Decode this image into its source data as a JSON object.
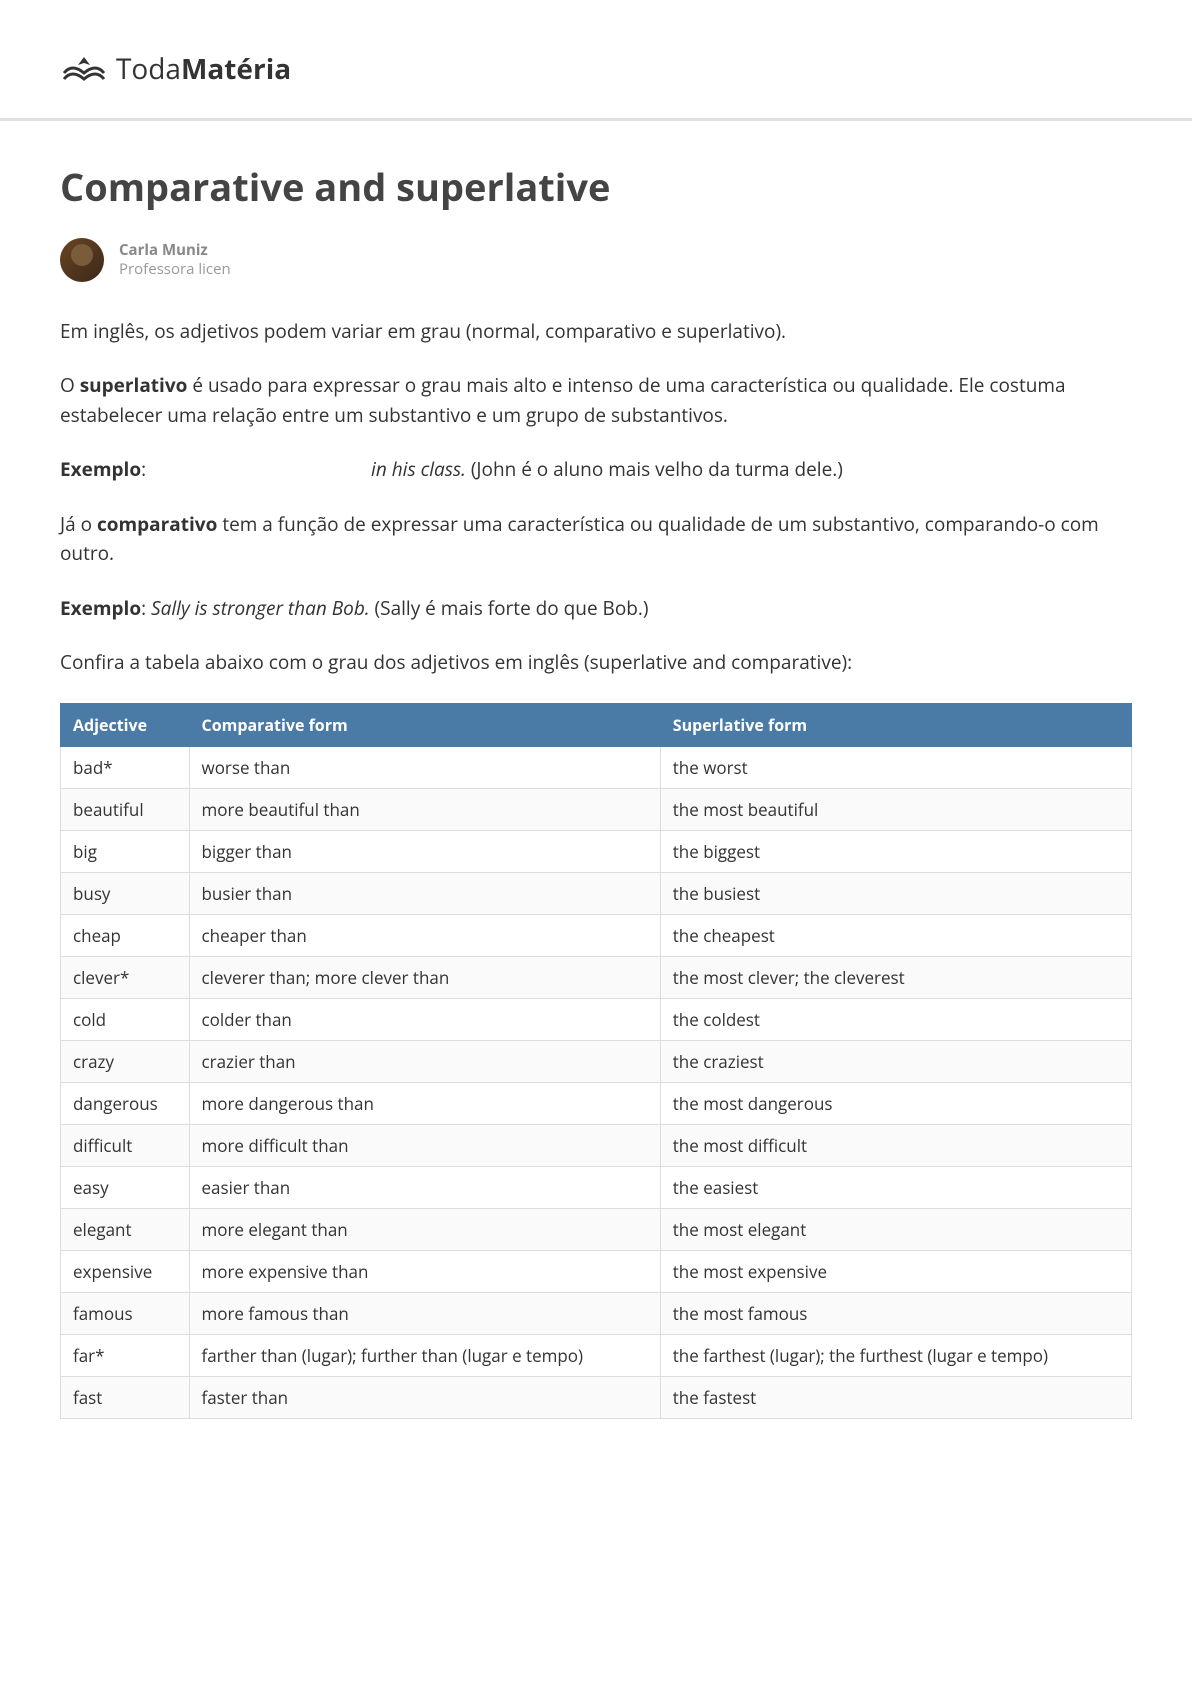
{
  "logo": {
    "part1": "Toda",
    "part2": "Matéria"
  },
  "title": "Comparative and superlative",
  "author": {
    "name": "Carla Muniz",
    "role": "Professora licen"
  },
  "paragraphs": {
    "p1": "Em inglês, os adjetivos podem variar em grau (normal, comparativo e superlativo).",
    "p2_before": "O ",
    "p2_strong": "superlativo",
    "p2_after": " é usado para expressar o grau mais alto e intenso de uma característica ou qualidade. Ele costuma estabelecer uma relação entre um substantivo e um grupo de substantivos.",
    "p3_label": "Exemplo",
    "p3_italic": "in his class.",
    "p3_after": " (John é o aluno mais velho da turma dele.)",
    "p4_before": "Já o ",
    "p4_strong": "comparativo",
    "p4_after": " tem a função de expressar uma característica ou qualidade de um substantivo, comparando-o com outro.",
    "p5_label": "Exemplo",
    "p5_italic": "Sally is stronger than Bob.",
    "p5_after": " (Sally é mais forte do que Bob.)",
    "p6": "Confira a tabela abaixo com o grau dos adjetivos em inglês (superlative and comparative):"
  },
  "table": {
    "headers": {
      "adj": "Adjective",
      "comp": "Comparative form",
      "sup": "Superlative form"
    },
    "rows": [
      {
        "adj": "bad*",
        "comp": "worse than",
        "sup": "the worst"
      },
      {
        "adj": "beautiful",
        "comp": "more beautiful than",
        "sup": "the most beautiful"
      },
      {
        "adj": "big",
        "comp": "bigger than",
        "sup": "the biggest"
      },
      {
        "adj": "busy",
        "comp": "busier than",
        "sup": "the busiest"
      },
      {
        "adj": "cheap",
        "comp": "cheaper than",
        "sup": "the cheapest"
      },
      {
        "adj": "clever*",
        "comp": "cleverer than; more clever than",
        "sup": "the most clever; the cleverest"
      },
      {
        "adj": "cold",
        "comp": "colder than",
        "sup": "the coldest"
      },
      {
        "adj": "crazy",
        "comp": "crazier than",
        "sup": "the craziest"
      },
      {
        "adj": "dangerous",
        "comp": "more dangerous than",
        "sup": "the most dangerous"
      },
      {
        "adj": "difficult",
        "comp": "more difficult than",
        "sup": "the most difficult"
      },
      {
        "adj": "easy",
        "comp": "easier than",
        "sup": "the easiest"
      },
      {
        "adj": "elegant",
        "comp": "more elegant than",
        "sup": "the most elegant"
      },
      {
        "adj": "expensive",
        "comp": "more expensive than",
        "sup": "the most expensive"
      },
      {
        "adj": "famous",
        "comp": "more famous than",
        "sup": "the most famous"
      },
      {
        "adj": "far*",
        "comp": "farther than (lugar); further than (lugar e tempo)",
        "sup": "the farthest (lugar); the furthest (lugar e tempo)"
      },
      {
        "adj": "fast",
        "comp": "faster than",
        "sup": "the fastest"
      }
    ]
  }
}
